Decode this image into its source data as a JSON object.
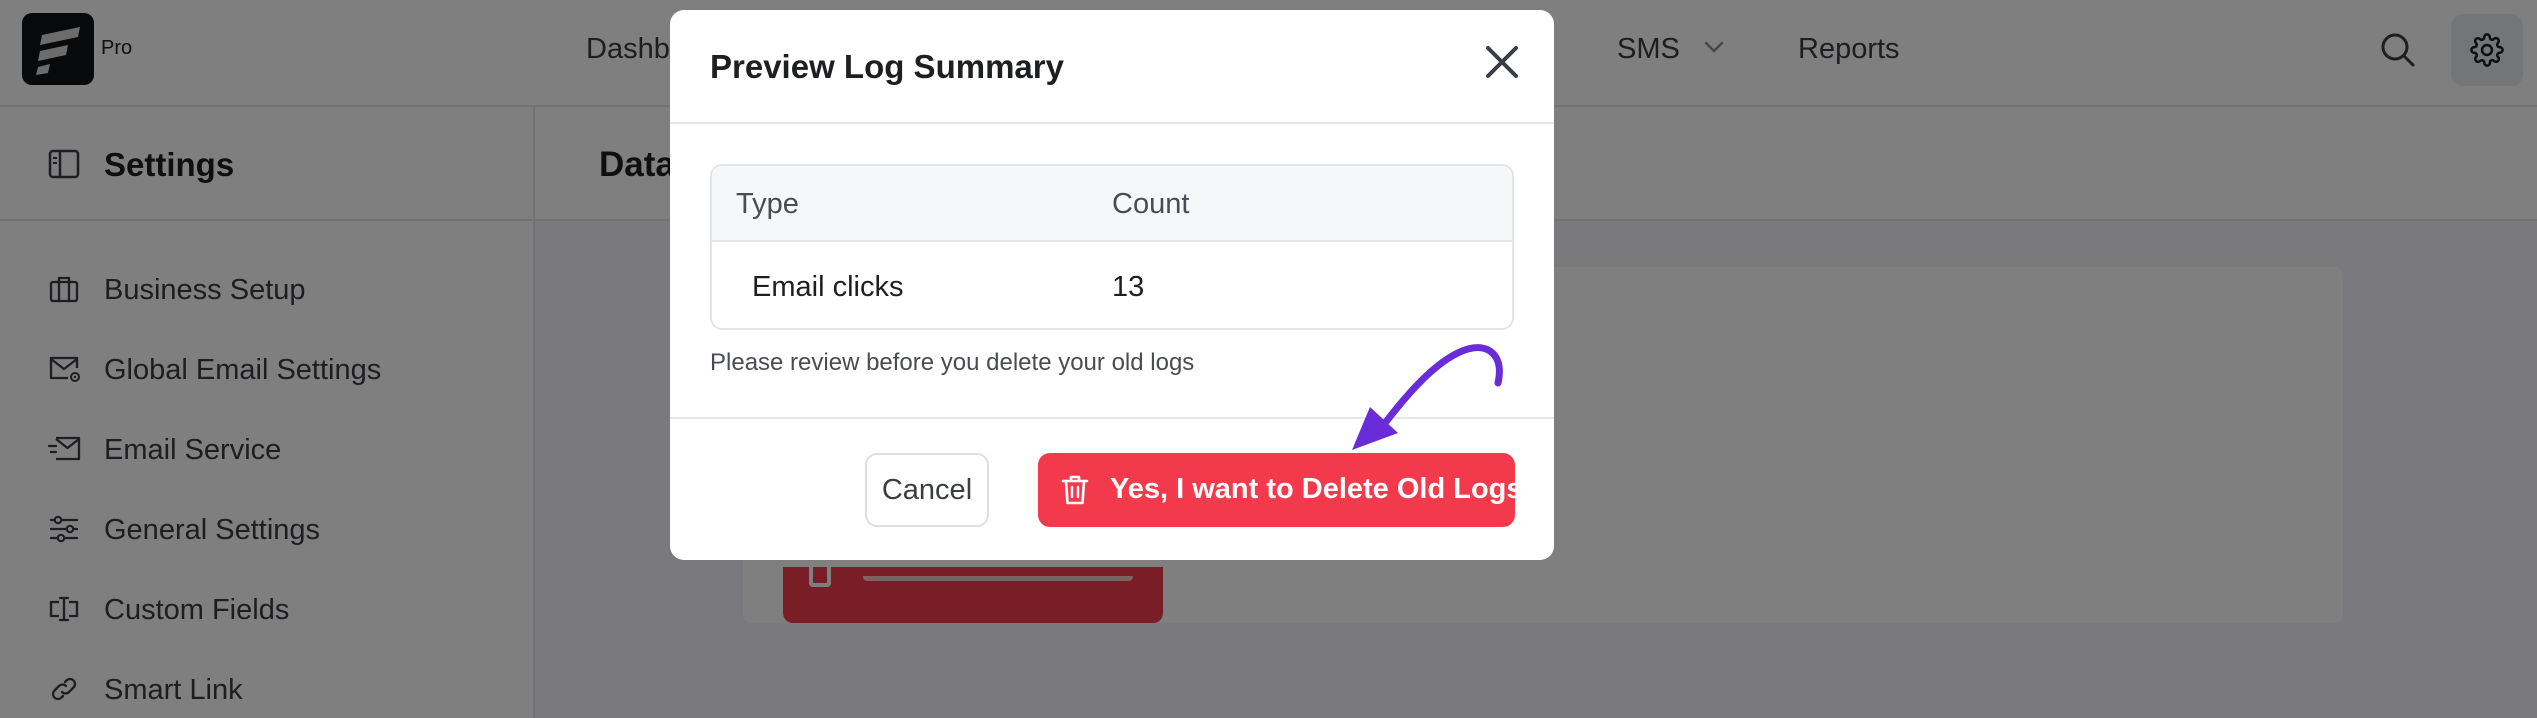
{
  "topbar": {
    "pro_label": "Pro",
    "nav": {
      "dashboard": "Dashb",
      "sms": "SMS",
      "reports": "Reports"
    },
    "icons": {
      "search": "search-icon",
      "settings": "gear-icon",
      "chevron": "chevron-down-icon"
    }
  },
  "sidebar": {
    "title": "Settings",
    "items": [
      {
        "label": "Business Setup",
        "icon": "briefcase-icon"
      },
      {
        "label": "Global Email Settings",
        "icon": "mail-settings-icon"
      },
      {
        "label": "Email Service",
        "icon": "mail-send-icon"
      },
      {
        "label": "General Settings",
        "icon": "sliders-icon"
      },
      {
        "label": "Custom Fields",
        "icon": "custom-field-icon"
      },
      {
        "label": "Smart Link",
        "icon": "link-icon"
      }
    ]
  },
  "main": {
    "title": "Data"
  },
  "modal": {
    "title": "Preview Log Summary",
    "table": {
      "headers": [
        "Type",
        "Count"
      ],
      "rows": [
        [
          "Email clicks",
          "13"
        ]
      ]
    },
    "note": "Please review before you delete your old logs",
    "cancel_label": "Cancel",
    "confirm_label": "Yes, I want to Delete Old Logs"
  },
  "colors": {
    "danger": "#f33a4c",
    "annotation_arrow": "#6a2bd9",
    "overlay": "rgba(0,0,0,0.5)"
  }
}
